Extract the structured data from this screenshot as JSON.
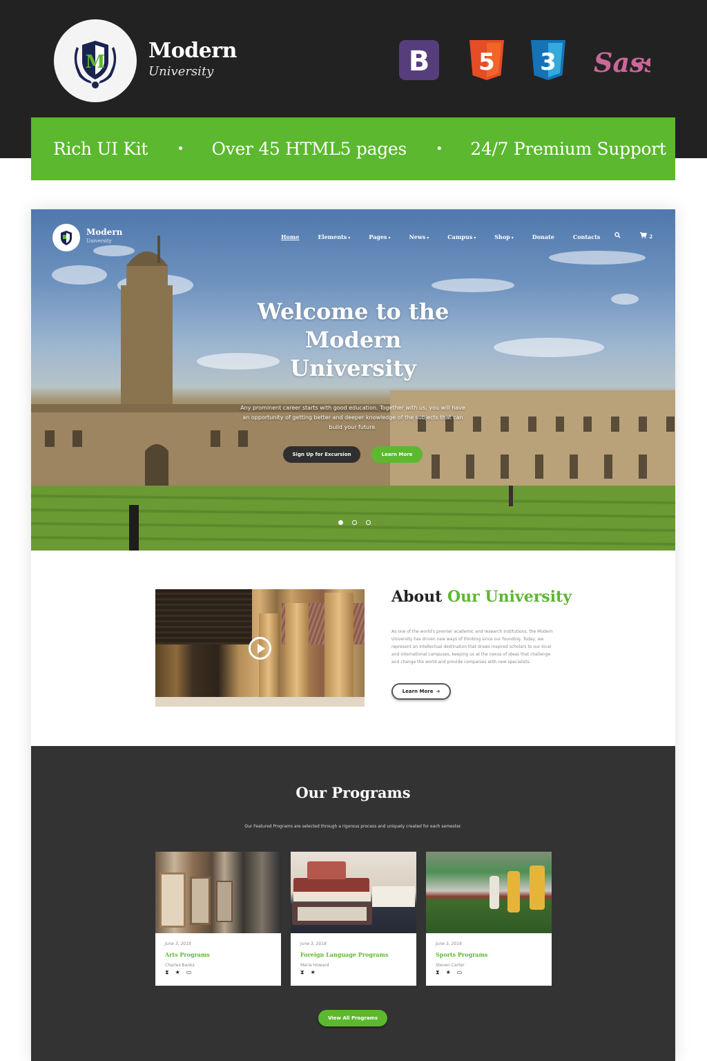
{
  "header": {
    "brand_name": "Modern",
    "brand_subtitle": "University",
    "logo_letter": "M",
    "tech_badges": [
      {
        "name": "bootstrap",
        "label": "B",
        "color": "#563d7c"
      },
      {
        "name": "html5",
        "label": "5",
        "color": "#e44d26"
      },
      {
        "name": "css3",
        "label": "3",
        "color": "#1572b6"
      },
      {
        "name": "sass",
        "label": "Sass",
        "color": "#cd6799"
      }
    ]
  },
  "features": {
    "items": [
      "Rich UI Kit",
      "Over 45 HTML5 pages",
      "24/7 Premium Support"
    ],
    "separator": "•",
    "background": "#5cb82f"
  },
  "preview": {
    "nav": {
      "brand_name": "Modern",
      "brand_subtitle": "University",
      "items": [
        {
          "label": "Home",
          "dropdown": false,
          "active": true
        },
        {
          "label": "Elements",
          "dropdown": true
        },
        {
          "label": "Pages",
          "dropdown": true
        },
        {
          "label": "News",
          "dropdown": true
        },
        {
          "label": "Campus",
          "dropdown": true
        },
        {
          "label": "Shop",
          "dropdown": true
        },
        {
          "label": "Donate",
          "dropdown": false
        },
        {
          "label": "Contacts",
          "dropdown": false
        }
      ],
      "search_icon": "search-icon",
      "cart_icon": "cart-icon",
      "cart_count": "2"
    },
    "hero": {
      "title_lines": [
        "Welcome to the",
        "Modern",
        "University"
      ],
      "text": "Any prominent career starts with good education. Together with us, you will have an opportunity of getting better and deeper knowledge of the subjects that can build your future.",
      "primary_button": "Sign Up for Excursion",
      "secondary_button": "Learn More",
      "slides": 3,
      "active_slide": 1
    },
    "about": {
      "title_plain": "About",
      "title_accent": "Our University",
      "text": "As one of the world's premier academic and research institutions, the Modern University has driven new ways of thinking since our founding. Today, we represent an intellectual destination that draws inspired scholars to our local and international campuses, keeping us at the nexus of ideas that challenge and change the world and provide companies with new specialists.",
      "button": "Learn More",
      "button_icon": "arrow-right-icon"
    },
    "programs": {
      "title": "Our Programs",
      "subtitle": "Our Featured Programs are selected through a rigorous process and uniquely created for each semester.",
      "cards": [
        {
          "date": "June 3, 2018",
          "name": "Arts Programs",
          "author": "Charles Banks",
          "icons": [
            "hourglass-icon",
            "star-icon",
            "laptop-icon"
          ]
        },
        {
          "date": "June 3, 2018",
          "name": "Foreign Language Programs",
          "author": "Maria Howard",
          "icons": [
            "hourglass-icon",
            "star-icon"
          ]
        },
        {
          "date": "June 3, 2018",
          "name": "Sports Programs",
          "author": "Steven Carter",
          "icons": [
            "hourglass-icon",
            "star-icon",
            "laptop-icon"
          ]
        }
      ],
      "button": "View All Programs"
    }
  },
  "colors": {
    "accent": "#5cb82f",
    "dark": "#232222",
    "section_dark": "#333333"
  }
}
